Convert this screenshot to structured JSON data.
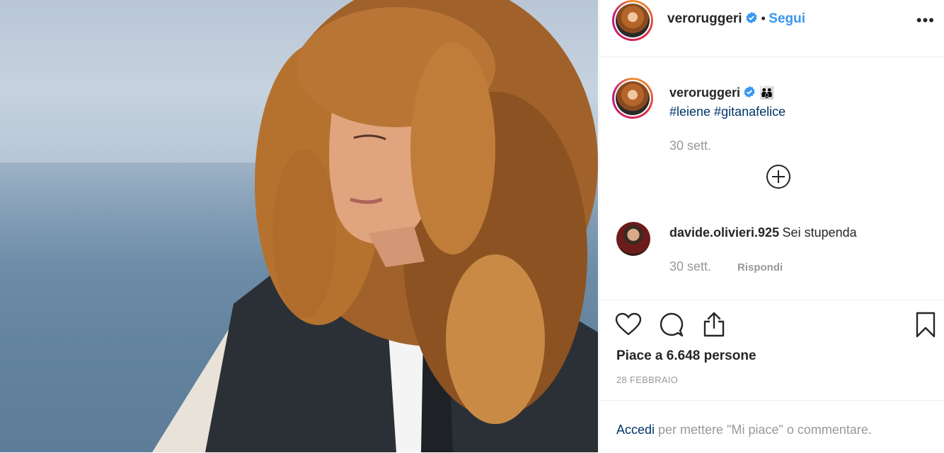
{
  "header": {
    "username": "veroruggeri",
    "separator": "•",
    "follow_label": "Segui",
    "more_label": "•••"
  },
  "caption": {
    "username": "veroruggeri",
    "emoji": "👨‍👨‍👦",
    "hashtags": "#leiene #gitanafelice",
    "time": "30 sett."
  },
  "comments": [
    {
      "username": "davide.olivieri.925",
      "text": "Sei stupenda",
      "time": "30 sett.",
      "reply_label": "Rispondi"
    }
  ],
  "actions": {
    "icons": [
      "heart-icon",
      "comment-icon",
      "share-icon",
      "bookmark-icon"
    ]
  },
  "likes": "Piace a 6.648 persone",
  "date": "28 FEBBRAIO",
  "login": {
    "link": "Accedi",
    "text": " per mettere \"Mi piace\" o commentare."
  },
  "colors": {
    "link_blue": "#3897f0",
    "hashtag_blue": "#003569",
    "muted": "#999999",
    "text": "#262626"
  }
}
